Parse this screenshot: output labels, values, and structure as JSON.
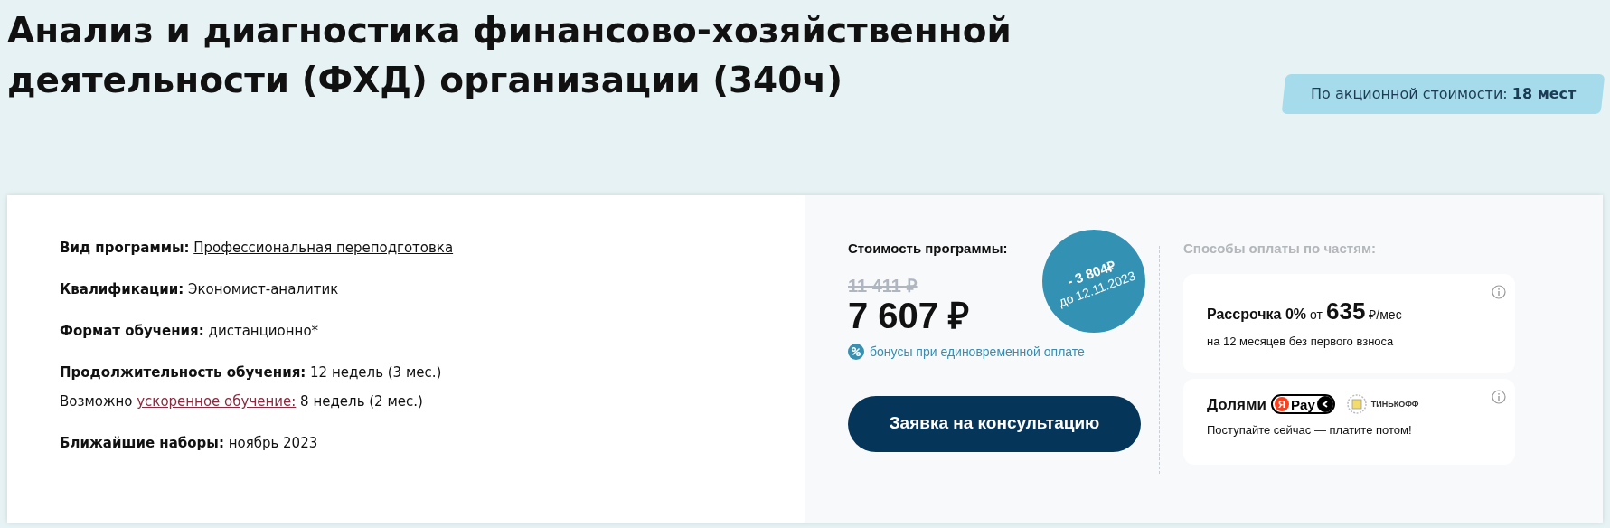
{
  "title": "Анализ и диагностика финансово-хозяйственной деятельности (ФХД) организации (340ч)",
  "promo_badge": {
    "text": "По акционной стоимости:",
    "count": "18 мест"
  },
  "details": [
    {
      "label": "Вид программы:",
      "value": "Профессиональная переподготовка",
      "kind": "link"
    },
    {
      "label": "Квалификации:",
      "value": "Экономист-аналитик",
      "kind": "text"
    },
    {
      "label": "Формат обучения:",
      "value": "дистанционно*",
      "kind": "text"
    },
    {
      "label": "Продолжительность обучения:",
      "value": "12 недель (3 мес.)",
      "kind": "text",
      "note": {
        "prefix": "Возможно",
        "link": "ускоренное обучение:",
        "suffix": "8 недель (2 мес.)"
      }
    },
    {
      "label": "Ближайшие наборы:",
      "value": "ноябрь 2023",
      "kind": "text"
    }
  ],
  "price": {
    "heading": "Стоимость программы:",
    "old_price": "11 411 ₽",
    "new_price": "7 607 ₽",
    "discount": "- 3 804₽",
    "discount_until": "до 12.11.2023",
    "bonus": "бонусы при единовременной оплате",
    "button": "Заявка на консультацию"
  },
  "payment": {
    "heading": "Способы оплаты по частям:",
    "installment": {
      "title": "Рассрочка 0%",
      "from": "от",
      "amount": "635",
      "unit": "₽/мес",
      "subtitle": "на 12 месяцев без первого взноса"
    },
    "dolyami": {
      "title": "Долями",
      "yandex_letter": "Я",
      "yandex_pay": "Pay",
      "bank": "ТИНЬКОФФ",
      "subtitle": "Поступайте сейчас — платите потом!"
    }
  }
}
